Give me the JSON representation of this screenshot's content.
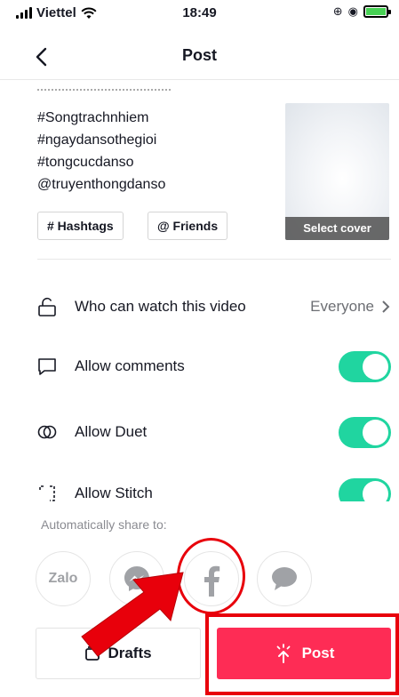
{
  "status_bar": {
    "carrier": "Viettel",
    "time": "18:49"
  },
  "nav": {
    "title": "Post"
  },
  "caption": {
    "lines": [
      "#Songtrachnhiem",
      "#ngaydansothegioi",
      "#tongcucdanso",
      "@truyenthongdanso"
    ]
  },
  "tags": {
    "hashtags": "# Hashtags",
    "friends": "@ Friends"
  },
  "cover": {
    "label": "Select cover"
  },
  "settings": {
    "who_can_watch": {
      "label": "Who can watch this video",
      "value": "Everyone"
    },
    "allow_comments": {
      "label": "Allow comments",
      "enabled": true
    },
    "allow_duet": {
      "label": "Allow Duet",
      "enabled": true
    },
    "allow_stitch": {
      "label": "Allow Stitch",
      "enabled": true
    }
  },
  "share": {
    "title": "Automatically share to:",
    "zalo_label": "Zalo",
    "targets": [
      "zalo",
      "messenger",
      "facebook",
      "message"
    ]
  },
  "buttons": {
    "drafts": "Drafts",
    "post": "Post"
  },
  "colors": {
    "accent": "#fe2c55",
    "toggle": "#20d5a0",
    "annotation": "#e8000b"
  }
}
